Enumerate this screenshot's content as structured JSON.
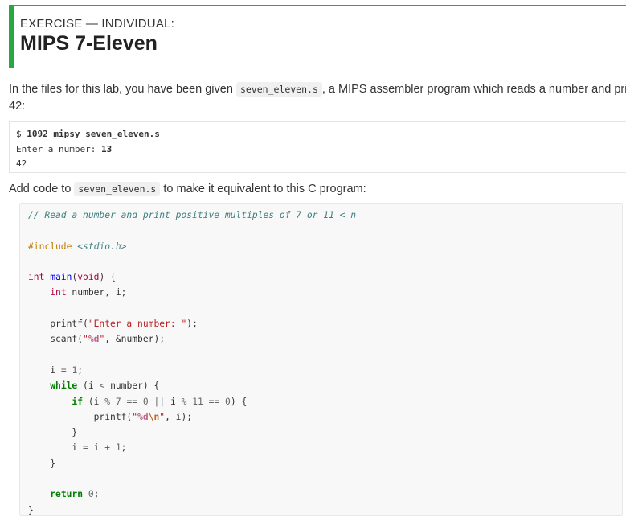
{
  "header": {
    "eyebrow": "EXERCISE — INDIVIDUAL:",
    "title": "MIPS 7-Eleven",
    "accent_color": "#28a745"
  },
  "intro": {
    "text_before": "In the files for this lab, you have been given ",
    "file_name": "seven_eleven.s",
    "text_after": ", a MIPS assembler program which reads a number and prints",
    "line2": "42:"
  },
  "shell": {
    "prompt": "$ ",
    "command": "1092 mipsy seven_eleven.s",
    "prompt_text": "Enter a number: ",
    "input_value": "13",
    "output": "42"
  },
  "instruction": {
    "text_before": "Add code to ",
    "file_name": "seven_eleven.s",
    "text_after": " to make it equivalent to this C program:"
  },
  "code": {
    "comment": "// Read a number and print positive multiples of 7 or 11 < n",
    "include_directive": "#include",
    "include_file": "<stdio.h>",
    "main_sig": [
      "int",
      " ",
      "main",
      "(",
      "void",
      ") {"
    ],
    "decl": [
      "    ",
      "int",
      " number, i;"
    ],
    "printf1": [
      "    printf(",
      "\"Enter a number: \"",
      ");"
    ],
    "scanf": [
      "    scanf(",
      "\"",
      "%d",
      "\"",
      ", &number);"
    ],
    "assign": [
      "    i ",
      "=",
      " ",
      "1",
      ";"
    ],
    "while_line": [
      "    ",
      "while",
      " (i ",
      "<",
      " number) {"
    ],
    "if_line": [
      "        ",
      "if",
      " (i ",
      "%",
      " ",
      "7",
      " ",
      "==",
      " ",
      "0",
      " ",
      "||",
      " i ",
      "%",
      " ",
      "11",
      " ",
      "==",
      " ",
      "0",
      ") {"
    ],
    "printf2": [
      "            printf(",
      "\"",
      "%d",
      "\\n",
      "\"",
      ", i);"
    ],
    "close_if": "        }",
    "incr": [
      "        i ",
      "=",
      " i ",
      "+",
      " ",
      "1",
      ";"
    ],
    "close_while": "    }",
    "return_line": [
      "    ",
      "return",
      " ",
      "0",
      ";"
    ],
    "close_main": "}"
  }
}
